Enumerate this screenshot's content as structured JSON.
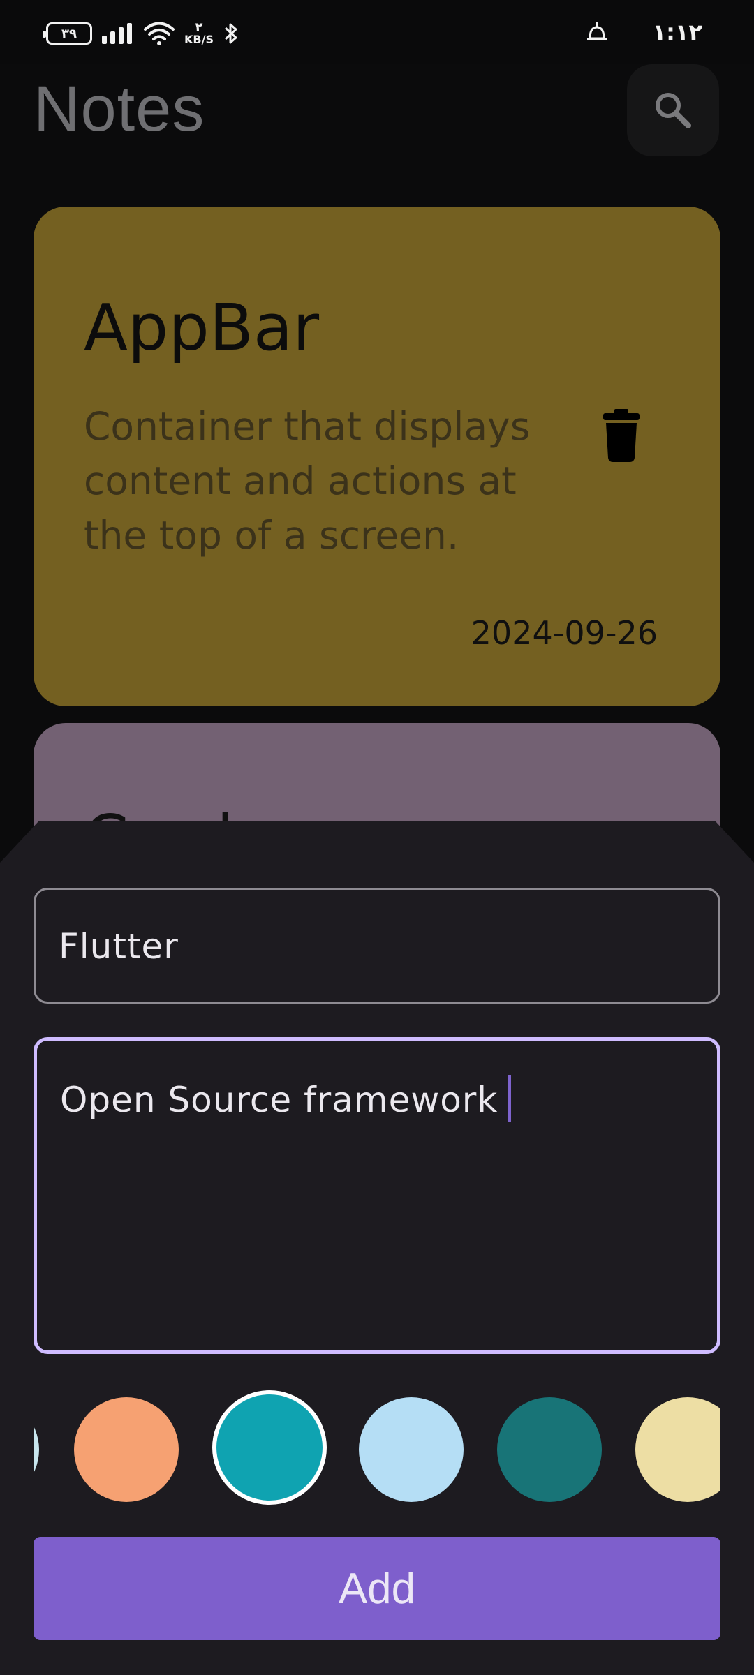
{
  "status_bar": {
    "battery": "٣٩",
    "net_speed_value": "٢",
    "net_speed_unit": "KB/S",
    "time": "١:١٢"
  },
  "app_bar": {
    "title": "Notes",
    "search_icon": "search-icon"
  },
  "notes": [
    {
      "title": "AppBar",
      "body": "Container that displays content and actions at the top of a screen.",
      "date": "2024-09-26",
      "color": "#746021",
      "delete_icon": "trash-icon"
    },
    {
      "title": "Card",
      "color": "#736173"
    }
  ],
  "sheet": {
    "title_value": "Flutter",
    "description_value": "Open Source framework",
    "colors": [
      "#c8e6ee",
      "#f6a172",
      "#0fa3b1",
      "#b5def5",
      "#187477",
      "#eddea4"
    ],
    "selected_color_index": 2,
    "add_label": "Add",
    "accent": "#7e5fcc"
  }
}
